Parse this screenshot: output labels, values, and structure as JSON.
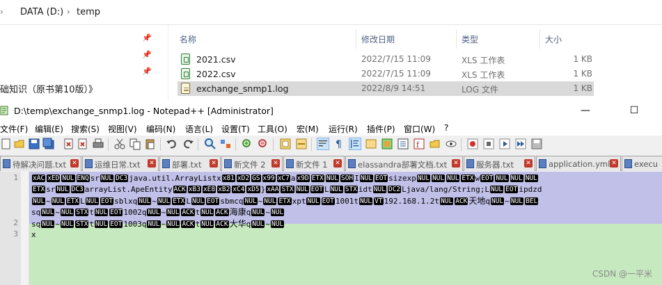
{
  "explorer": {
    "address": {
      "drive": "DATA (D:)",
      "folder": "temp"
    },
    "nav": {
      "truncated_item": "础知识（原书第10版）》"
    },
    "columns": {
      "name": "名称",
      "date": "修改日期",
      "type": "类型",
      "size": "大小"
    },
    "files": [
      {
        "name": "2021.csv",
        "date": "2022/7/15 11:09",
        "type": "XLS 工作表",
        "size": "1 KB",
        "icon": "excel-csv-icon",
        "selected": false
      },
      {
        "name": "2022.csv",
        "date": "2022/7/15 11:09",
        "type": "XLS 工作表",
        "size": "1 KB",
        "icon": "excel-csv-icon",
        "selected": false
      },
      {
        "name": "exchange_snmp1.log",
        "date": "2022/8/9 14:51",
        "type": "LOG 文件",
        "size": "1 KB",
        "icon": "log-file-icon",
        "selected": true
      }
    ]
  },
  "notepad": {
    "title": "D:\\temp\\exchange_snmp1.log - Notepad++ [Administrator]",
    "window_buttons": {
      "minimize": "—",
      "maximize": "☐"
    },
    "menu": [
      "文件(F)",
      "编辑(E)",
      "搜索(S)",
      "视图(V)",
      "编码(N)",
      "语言(L)",
      "设置(T)",
      "工具(O)",
      "宏(M)",
      "运行(R)",
      "插件(P)",
      "窗口(W)",
      "?"
    ],
    "tabs": [
      {
        "label": "待解决问题.txt"
      },
      {
        "label": "运维日常.txt"
      },
      {
        "label": "部署.txt"
      },
      {
        "label": "新文件 2"
      },
      {
        "label": "新文件 1"
      },
      {
        "label": "elassandra部署文档.txt"
      },
      {
        "label": "服务器.txt"
      },
      {
        "label": "application.yml"
      },
      {
        "label": "execu"
      }
    ],
    "line_numbers": [
      "1",
      "2",
      "3"
    ],
    "lines": {
      "l1a": [
        {
          "c": "xAC"
        },
        {
          "c": "xED"
        },
        {
          "c": "NUL"
        },
        {
          "c": "ENQ"
        },
        {
          "t": "sr"
        },
        {
          "c": "NUL"
        },
        {
          "c": "DC3"
        },
        {
          "t": "java.util.ArrayListx"
        },
        {
          "c": "x81"
        },
        {
          "c": "xD2"
        },
        {
          "c": "GS"
        },
        {
          "c": "x99"
        },
        {
          "c": "xC7"
        },
        {
          "t": "a"
        },
        {
          "c": "x9D"
        },
        {
          "c": "ETX"
        },
        {
          "c": "NUL"
        },
        {
          "c": "SOH"
        },
        {
          "t": "I"
        },
        {
          "c": "NUL"
        },
        {
          "c": "EOT"
        },
        {
          "t": "sizexp"
        },
        {
          "c": "NUL"
        },
        {
          "c": "NUL"
        },
        {
          "c": "NUL"
        },
        {
          "c": "ETX"
        },
        {
          "t": "w"
        },
        {
          "c": "EOT"
        },
        {
          "c": "NUL"
        },
        {
          "c": "NUL"
        },
        {
          "c": "NUL"
        }
      ],
      "l1b": [
        {
          "c": "ETX"
        },
        {
          "t": "sr"
        },
        {
          "c": "NUL"
        },
        {
          "c": "DC3"
        },
        {
          "t": "arrayList.ApeEntity"
        },
        {
          "c": "ACK"
        },
        {
          "c": "xB3"
        },
        {
          "c": "xE8"
        },
        {
          "c": "xB2"
        },
        {
          "c": "xC4"
        },
        {
          "c": "xD5"
        },
        {
          "t": "}"
        },
        {
          "c": "xAA"
        },
        {
          "c": "STX"
        },
        {
          "c": "NUL"
        },
        {
          "c": "EOT"
        },
        {
          "t": "L"
        },
        {
          "c": "NUL"
        },
        {
          "c": "STX"
        },
        {
          "t": "idt"
        },
        {
          "c": "NUL"
        },
        {
          "c": "DC2"
        },
        {
          "t": "Ljava/lang/String;L"
        },
        {
          "c": "NUL"
        },
        {
          "c": "EOT"
        },
        {
          "t": "ipdzd"
        }
      ],
      "l1c": [
        {
          "c": "NUL"
        },
        {
          "t": "~"
        },
        {
          "c": "NUL"
        },
        {
          "c": "ETX"
        },
        {
          "t": "L"
        },
        {
          "c": "NUL"
        },
        {
          "c": "EOT"
        },
        {
          "t": "sblxq"
        },
        {
          "c": "NUL"
        },
        {
          "t": "~"
        },
        {
          "c": "NUL"
        },
        {
          "c": "ETX"
        },
        {
          "t": "L"
        },
        {
          "c": "NUL"
        },
        {
          "c": "EOT"
        },
        {
          "t": "sbmcq"
        },
        {
          "c": "NUL"
        },
        {
          "t": "~"
        },
        {
          "c": "NUL"
        },
        {
          "c": "ETX"
        },
        {
          "t": "xpt"
        },
        {
          "c": "NUL"
        },
        {
          "c": "EOT"
        },
        {
          "t": "1001t"
        },
        {
          "c": "NUL"
        },
        {
          "c": "VT"
        },
        {
          "t": "192.168.1.2t"
        },
        {
          "c": "NUL"
        },
        {
          "c": "ACK"
        },
        {
          "n": "天地"
        },
        {
          "t": "q"
        },
        {
          "c": "NUL"
        },
        {
          "t": "~"
        },
        {
          "c": "NUL"
        },
        {
          "c": "BEL"
        }
      ],
      "l1d": [
        {
          "t": "sq"
        },
        {
          "c": "NUL"
        },
        {
          "t": "~"
        },
        {
          "c": "NUL"
        },
        {
          "c": "STX"
        },
        {
          "t": "t"
        },
        {
          "c": "NUL"
        },
        {
          "c": "EOT"
        },
        {
          "t": "1002q"
        },
        {
          "c": "NUL"
        },
        {
          "t": "~"
        },
        {
          "c": "NUL"
        },
        {
          "c": "ACK"
        },
        {
          "t": "t"
        },
        {
          "c": "NUL"
        },
        {
          "c": "ACK"
        },
        {
          "n": "海康"
        },
        {
          "t": "q"
        },
        {
          "c": "NUL"
        },
        {
          "t": "~"
        },
        {
          "c": "NUL"
        }
      ],
      "l2": [
        {
          "t": "sq"
        },
        {
          "c": "NUL"
        },
        {
          "t": "~"
        },
        {
          "c": "NUL"
        },
        {
          "c": "STX"
        },
        {
          "t": "t"
        },
        {
          "c": "NUL"
        },
        {
          "c": "EOT"
        },
        {
          "t": "1003q"
        },
        {
          "c": "NUL"
        },
        {
          "t": "~"
        },
        {
          "c": "NUL"
        },
        {
          "c": "ACK"
        },
        {
          "t": "t"
        },
        {
          "c": "NUL"
        },
        {
          "c": "ACK"
        },
        {
          "n": "大华"
        },
        {
          "t": "q"
        },
        {
          "c": "NUL"
        },
        {
          "t": "~"
        },
        {
          "c": "NUL"
        }
      ],
      "l3": [
        {
          "t": "x"
        }
      ]
    },
    "watermark": "CSDN @一平米"
  }
}
